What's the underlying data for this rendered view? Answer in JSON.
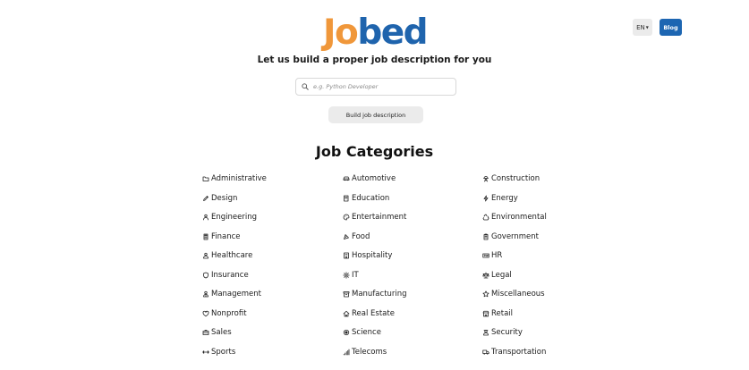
{
  "logo": {
    "part1": "Jo",
    "part2": "bed",
    "color1": "#f0973a",
    "color2": "#1f64ad"
  },
  "header": {
    "language": "EN",
    "blog_label": "Blog"
  },
  "tagline": "Let us build a proper job description for you",
  "search": {
    "placeholder": "e.g. Python Developer",
    "value": ""
  },
  "build_label": "Build job description",
  "categories_title": "Job Categories",
  "categories": [
    {
      "label": "Administrative",
      "icon": "folder-icon"
    },
    {
      "label": "Automotive",
      "icon": "car-icon"
    },
    {
      "label": "Construction",
      "icon": "worker-icon"
    },
    {
      "label": "Design",
      "icon": "pencil-icon"
    },
    {
      "label": "Education",
      "icon": "book-icon"
    },
    {
      "label": "Energy",
      "icon": "lightning-icon"
    },
    {
      "label": "Engineering",
      "icon": "engineer-icon"
    },
    {
      "label": "Entertainment",
      "icon": "palette-icon"
    },
    {
      "label": "Environmental",
      "icon": "recycle-icon"
    },
    {
      "label": "Finance",
      "icon": "calculator-icon"
    },
    {
      "label": "Food",
      "icon": "food-icon"
    },
    {
      "label": "Government",
      "icon": "clipboard-icon"
    },
    {
      "label": "Healthcare",
      "icon": "person-icon"
    },
    {
      "label": "Hospitality",
      "icon": "building-icon"
    },
    {
      "label": "HR",
      "icon": "id-card-icon"
    },
    {
      "label": "Insurance",
      "icon": "shield-icon"
    },
    {
      "label": "IT",
      "icon": "gear-icon"
    },
    {
      "label": "Legal",
      "icon": "scale-icon"
    },
    {
      "label": "Management",
      "icon": "manager-icon"
    },
    {
      "label": "Manufacturing",
      "icon": "box-icon"
    },
    {
      "label": "Miscellaneous",
      "icon": "star-icon"
    },
    {
      "label": "Nonprofit",
      "icon": "heart-icon"
    },
    {
      "label": "Real Estate",
      "icon": "house-icon"
    },
    {
      "label": "Retail",
      "icon": "shop-icon"
    },
    {
      "label": "Sales",
      "icon": "briefcase-icon"
    },
    {
      "label": "Science",
      "icon": "atom-icon"
    },
    {
      "label": "Security",
      "icon": "guard-icon"
    },
    {
      "label": "Sports",
      "icon": "dumbbell-icon"
    },
    {
      "label": "Telecoms",
      "icon": "signal-icon"
    },
    {
      "label": "Transportation",
      "icon": "truck-icon"
    }
  ]
}
